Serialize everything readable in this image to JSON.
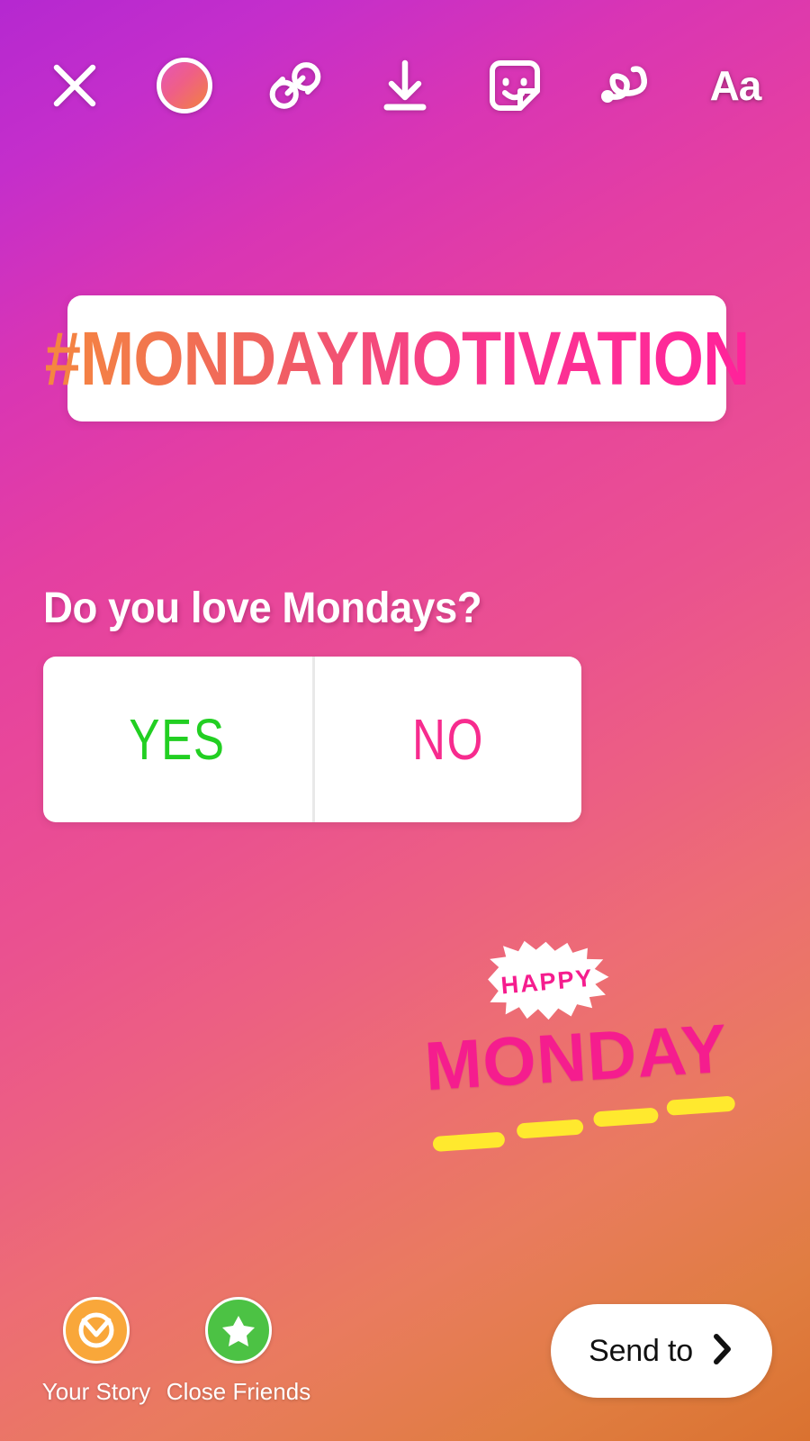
{
  "app": {
    "name": "Instagram Stories Editor",
    "screen": "story-composer"
  },
  "colors": {
    "background_start": "#B528D0",
    "background_mid": "#EA5190",
    "background_end": "#DA7230",
    "hashtag_gradient_start": "#F5873F",
    "hashtag_gradient_end": "#FF229A",
    "poll_yes": "#22CF22",
    "poll_no": "#F72B8E",
    "sticker_pink": "#F51D8E",
    "sticker_yellow": "#FFE92E",
    "your_story_ring": "#F9A73A",
    "close_friends": "#4CC244"
  },
  "toolbar": {
    "items": [
      {
        "name": "close",
        "icon": "close-x-icon",
        "label": ""
      },
      {
        "name": "music",
        "icon": "gradient-circle-icon",
        "label": ""
      },
      {
        "name": "link",
        "icon": "link-chain-icon",
        "label": ""
      },
      {
        "name": "save",
        "icon": "download-arrow-icon",
        "label": ""
      },
      {
        "name": "sticker",
        "icon": "sticker-smiley-icon",
        "label": ""
      },
      {
        "name": "draw",
        "icon": "squiggle-draw-icon",
        "label": ""
      },
      {
        "name": "text",
        "icon": "text-aa-icon",
        "label": "Aa"
      }
    ]
  },
  "canvas": {
    "hashtag_sticker": {
      "text": "#MONDAYMOTIVATION"
    },
    "poll_sticker": {
      "question": "Do you love Mondays?",
      "options": [
        {
          "label": "YES"
        },
        {
          "label": "NO"
        }
      ]
    },
    "gif_sticker": {
      "burst_text": "HAPPY",
      "word": "MONDAY",
      "dash_count": 4
    }
  },
  "bottom_bar": {
    "audiences": [
      {
        "label": "Your Story",
        "icon": "your-story-ring-icon"
      },
      {
        "label": "Close Friends",
        "icon": "close-friends-star-icon"
      }
    ],
    "send_to": {
      "label": "Send to",
      "icon": "chevron-right-icon"
    }
  }
}
